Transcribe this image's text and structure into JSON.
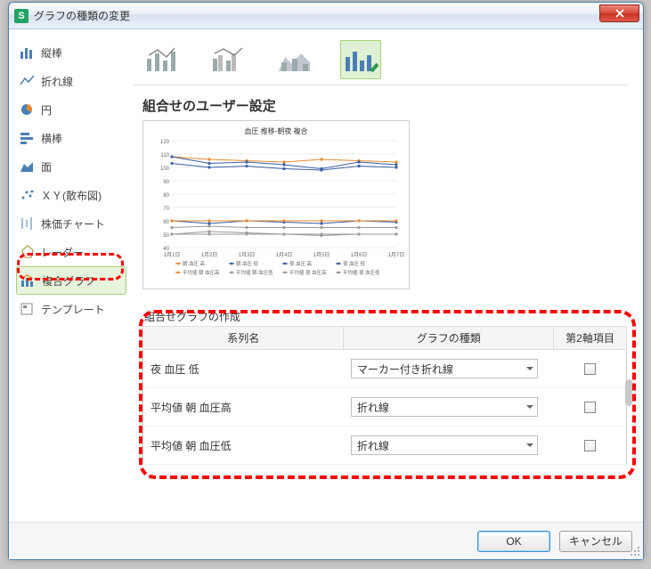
{
  "window": {
    "title": "グラフの種類の変更"
  },
  "sidebar": {
    "items": [
      {
        "label": "縦棒"
      },
      {
        "label": "折れ線"
      },
      {
        "label": "円"
      },
      {
        "label": "横棒"
      },
      {
        "label": "面"
      },
      {
        "label": "ＸＹ(散布図)"
      },
      {
        "label": "株価チャート"
      },
      {
        "label": "レーダー"
      },
      {
        "label": "複合グラフ"
      },
      {
        "label": "テンプレート"
      }
    ]
  },
  "section_title": "組合せのユーザー設定",
  "sub_title": "組合せグラフの作成",
  "chart_data": {
    "type": "line",
    "title": "血圧 推移-朝夜 複合",
    "xlabel": "",
    "ylabel": "",
    "ylim": [
      40,
      120
    ],
    "categories": [
      "1月1日",
      "1月2日",
      "1月3日",
      "1月4日",
      "1月5日",
      "1月6日",
      "1月7日"
    ],
    "series": [
      {
        "name": "朝 血圧 高",
        "values": [
          108,
          106,
          105,
          104,
          106,
          105,
          104
        ],
        "color": "#e58a2c"
      },
      {
        "name": "朝 血圧 低",
        "values": [
          108,
          103,
          104,
          102,
          99,
          104,
          102
        ],
        "color": "#3b5fa3"
      },
      {
        "name": "夜 血圧 高",
        "values": [
          103,
          100,
          101,
          99,
          98,
          101,
          100
        ],
        "color": "#3b5fa3"
      },
      {
        "name": "夜 血圧 低",
        "values": [
          60,
          58,
          60,
          59,
          58,
          60,
          59
        ],
        "color": "#3b5fa3"
      },
      {
        "name": "平均値 朝 血圧高",
        "values": [
          60,
          60,
          60,
          60,
          60,
          60,
          60
        ],
        "color": "#e58a2c"
      },
      {
        "name": "平均値 朝 血圧低",
        "values": [
          55,
          56,
          55,
          55,
          55,
          55,
          55
        ],
        "color": "#9a9a9a"
      },
      {
        "name": "平均値 夜 血圧高",
        "values": [
          50,
          52,
          51,
          50,
          49,
          50,
          50
        ],
        "color": "#9a9a9a"
      },
      {
        "name": "平均値 夜 血圧低",
        "values": [
          50,
          50,
          50,
          50,
          50,
          50,
          50
        ],
        "color": "#9a9a9a"
      }
    ]
  },
  "table": {
    "headers": {
      "col1": "系列名",
      "col2": "グラフの種類",
      "col3": "第2軸項目"
    },
    "rows": [
      {
        "name": "夜 血圧 低",
        "type": "マーカー付き折れ線"
      },
      {
        "name": "平均値 朝 血圧高",
        "type": "折れ線"
      },
      {
        "name": "平均値 朝 血圧低",
        "type": "折れ線"
      }
    ]
  },
  "buttons": {
    "ok": "OK",
    "cancel": "キャンセル"
  }
}
